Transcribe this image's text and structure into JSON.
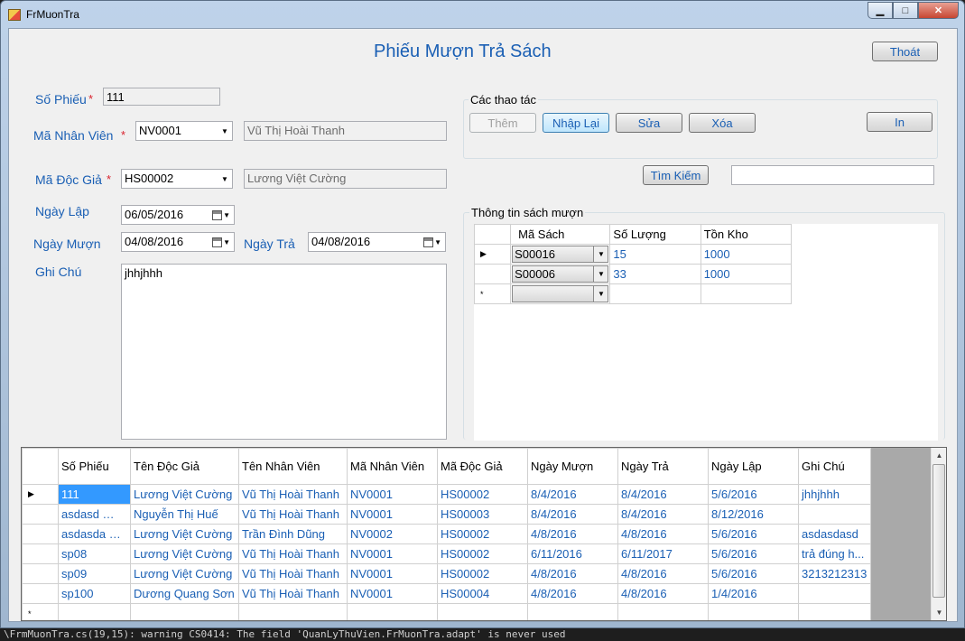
{
  "window": {
    "title": "FrMuonTra",
    "controls": {
      "minimize": "▁",
      "maximize": "□",
      "close": "✕"
    }
  },
  "form": {
    "heading": "Phiếu Mượn Trả Sách",
    "exit_label": "Thoát",
    "so_phieu": {
      "label": "Số Phiếu",
      "required": "*",
      "value": "111"
    },
    "ma_nhan_vien": {
      "label": "Mã Nhân Viên",
      "required": "*",
      "value": "NV0001",
      "name": "Vũ Thị Hoài Thanh"
    },
    "ma_doc_gia": {
      "label": "Mã Độc Giả",
      "required": "*",
      "value": "HS00002",
      "name": "Lương Việt Cường"
    },
    "ngay_lap": {
      "label": "Ngày Lập",
      "value": "06/05/2016"
    },
    "ngay_muon": {
      "label": "Ngày Mượn",
      "value": "04/08/2016"
    },
    "ngay_tra": {
      "label": "Ngày Trả",
      "value": "04/08/2016"
    },
    "ghi_chu": {
      "label": "Ghi Chú",
      "value": "jhhjhhh"
    }
  },
  "actions": {
    "group_label": "Các thao tác",
    "them": "Thêm",
    "nhap_lai": "Nhập Lại",
    "sua": "Sửa",
    "xoa": "Xóa",
    "in": "In",
    "tim_kiem": "Tìm Kiếm",
    "search_value": ""
  },
  "book_grid": {
    "group_label": "Thông tin sách mượn",
    "headers": [
      "Mã Sách",
      "Số Lượng",
      "Tồn Kho"
    ],
    "rows": [
      {
        "marker": "▶",
        "ma_sach": "S00016",
        "so_luong": "15",
        "ton_kho": "1000"
      },
      {
        "marker": "",
        "ma_sach": "S00006",
        "so_luong": "33",
        "ton_kho": "1000"
      },
      {
        "marker": "*",
        "ma_sach": "",
        "so_luong": "",
        "ton_kho": ""
      }
    ]
  },
  "main_grid": {
    "headers": [
      "Số Phiếu",
      "Tên Độc Giả",
      "Tên Nhân Viên",
      "Mã Nhân Viên",
      "Mã Độc Giả",
      "Ngày Mượn",
      "Ngày Trả",
      "Ngày Lập",
      "Ghi Chú"
    ],
    "rows": [
      {
        "marker": "▶",
        "cells": [
          "111",
          "Lương Việt Cường",
          "Vũ Thị Hoài Thanh",
          "NV0001",
          "HS00002",
          "8/4/2016",
          "8/4/2016",
          "5/6/2016",
          "jhhjhhh"
        ]
      },
      {
        "marker": "",
        "cells": [
          "asdasd …",
          "Nguyễn Thị Huế",
          "Vũ Thị Hoài Thanh",
          "NV0001",
          "HS00003",
          "8/4/2016",
          "8/4/2016",
          "8/12/2016",
          ""
        ]
      },
      {
        "marker": "",
        "cells": [
          "asdasda …",
          "Lương Việt Cường",
          "Trần Đình Dũng",
          "NV0002",
          "HS00002",
          "4/8/2016",
          "4/8/2016",
          "5/6/2016",
          "asdasdasd"
        ]
      },
      {
        "marker": "",
        "cells": [
          "sp08",
          "Lương Việt Cường",
          "Vũ Thị Hoài Thanh",
          "NV0001",
          "HS00002",
          "6/11/2016",
          "6/11/2017",
          "5/6/2016",
          "trả đúng h..."
        ]
      },
      {
        "marker": "",
        "cells": [
          "sp09",
          "Lương Việt Cường",
          "Vũ Thị Hoài Thanh",
          "NV0001",
          "HS00002",
          "4/8/2016",
          "4/8/2016",
          "5/6/2016",
          "3213212313"
        ]
      },
      {
        "marker": "",
        "cells": [
          "sp100",
          "Dương Quang Sơn",
          "Vũ Thị Hoài Thanh",
          "NV0001",
          "HS00004",
          "4/8/2016",
          "4/8/2016",
          "1/4/2016",
          ""
        ]
      },
      {
        "marker": "*",
        "cells": [
          "",
          "",
          "",
          "",
          "",
          "",
          "",
          "",
          ""
        ]
      }
    ]
  },
  "console": "\\FrmMuonTra.cs(19,15): warning CS0414: The field 'QuanLyThuVien.FrMuonTra.adapt' is never used"
}
